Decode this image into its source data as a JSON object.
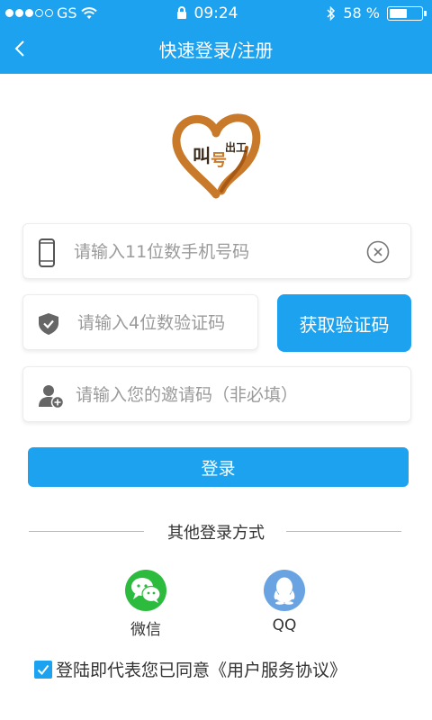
{
  "status_bar": {
    "carrier": "GS",
    "time": "09:24",
    "battery_percent": "58 %",
    "battery_level": 0.58
  },
  "header": {
    "title": "快速登录/注册",
    "back_icon": "chevron-left-icon"
  },
  "logo": {
    "text": "叫号出工"
  },
  "form": {
    "phone_placeholder": "请输入11位数手机号码",
    "code_placeholder": "请输入4位数验证码",
    "invite_placeholder": "请输入您的邀请码（非必填）",
    "get_code_label": "获取验证码",
    "login_label": "登录"
  },
  "other_login": {
    "label": "其他登录方式",
    "options": [
      {
        "name": "微信",
        "icon": "wechat-icon",
        "color": "#2dbb3e"
      },
      {
        "name": "QQ",
        "icon": "qq-icon",
        "color": "#6aa3e2"
      }
    ]
  },
  "agreement": {
    "checked": true,
    "text": "登陆即代表您已同意《用户服务协议》"
  },
  "colors": {
    "accent": "#1ca2ef"
  }
}
